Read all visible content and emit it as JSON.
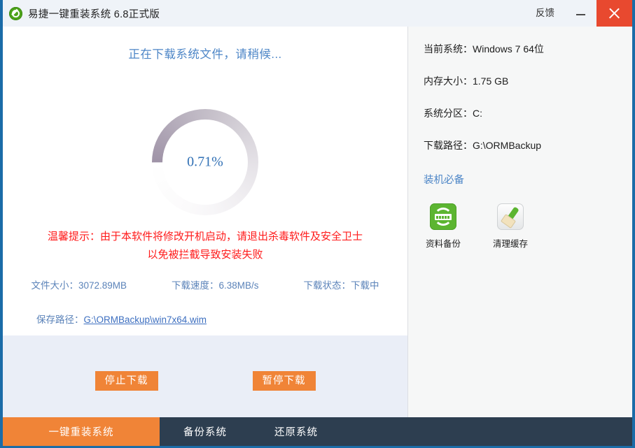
{
  "titlebar": {
    "app_name": "易捷一键重装系统 6.8正式版",
    "feedback_label": "反馈",
    "minimize_label": "最小化",
    "close_label": "关闭",
    "logo_icon": "green-check-logo-icon",
    "close_color": "#e8492f"
  },
  "main": {
    "heading": "正在下载系统文件，请稍候...",
    "progress": {
      "value_label": "0.71%",
      "percent": 0.71,
      "track_color": "#ffffff",
      "fill_color": "#9f93a7",
      "text_color": "#2f6fb4"
    },
    "warning": {
      "line1": "温馨提示：由于本软件将修改开机启动，请退出杀毒软件及安全卫士",
      "line2": "以免被拦截导致安装失败",
      "color": "#ff1a1a"
    },
    "status": {
      "file_size": "文件大小：3072.89MB",
      "speed": "下载速度：6.38MB/s",
      "state": "下载状态：下载中"
    },
    "save_path": {
      "label": "保存路径：",
      "value": "G:\\ORMBackup\\win7x64.wim"
    },
    "buttons": {
      "stop": "停止下载",
      "pause": "暂停下载",
      "color": "#f08437"
    }
  },
  "sidebar": {
    "info_rows": [
      "当前系统：Windows 7 64位",
      "内存大小：1.75 GB",
      "系统分区：C:",
      "下载路径：G:\\ORMBackup"
    ],
    "section_title": "装机必备",
    "tiles": [
      {
        "label": "资料备份",
        "icon": "data-backup-icon"
      },
      {
        "label": "清理缓存",
        "icon": "clean-cache-broom-icon"
      }
    ]
  },
  "tabbar": {
    "tabs": [
      {
        "label": "一键重装系统",
        "active": true
      },
      {
        "label": "备份系统",
        "active": false
      },
      {
        "label": "还原系统",
        "active": false
      }
    ],
    "active_color": "#f08437",
    "background": "#2d3e50"
  }
}
